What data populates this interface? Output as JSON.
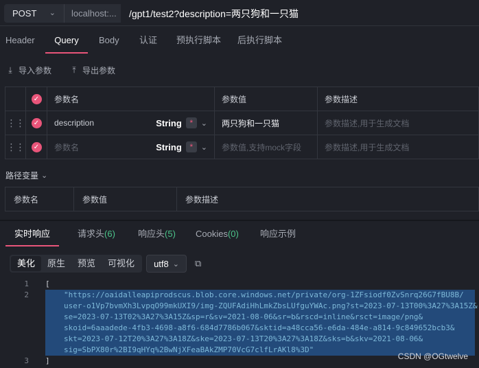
{
  "request": {
    "method": "POST",
    "host": "localhost:...",
    "path": "/gpt1/test2?description=两只狗和一只猫"
  },
  "tabs": [
    "Header",
    "Query",
    "Body",
    "认证",
    "预执行脚本",
    "后执行脚本"
  ],
  "active_tab": "Query",
  "toolbar": {
    "import_label": "导入参数",
    "export_label": "导出参数"
  },
  "params_table": {
    "headers": [
      "参数名",
      "参数值",
      "参数描述"
    ],
    "rows": [
      {
        "name": "description",
        "type": "String",
        "required_mark": "*",
        "value": "两只狗和一只猫",
        "desc_placeholder": "参数描述,用于生成文档"
      },
      {
        "name_placeholder": "参数名",
        "type": "String",
        "required_mark": "*",
        "value_placeholder": "参数值,支持mock字段",
        "desc_placeholder": "参数描述,用于生成文档"
      }
    ]
  },
  "path_vars": {
    "label": "路径变量",
    "headers": [
      "参数名",
      "参数值",
      "参数描述"
    ]
  },
  "response_tabs": {
    "realtime": "实时响应",
    "req_headers": "请求头",
    "req_headers_count": "(6)",
    "resp_headers": "响应头",
    "resp_headers_count": "(5)",
    "cookies": "Cookies",
    "cookies_count": "(0)",
    "example": "响应示例"
  },
  "format": {
    "buttons": [
      "美化",
      "原生",
      "预览",
      "可视化"
    ],
    "active": "美化",
    "encoding": "utf8"
  },
  "code": {
    "line_numbers": [
      "1",
      "2",
      "3"
    ],
    "open": "[",
    "close": "]",
    "string_lines": [
      "\"https://oaidalleapiprodscus.blob.core.windows.net/private/org-1ZFsiodf0ZvSnrq26G7fBU8B/",
      "user-o1Vp7bvmXh3LvpqO99mkUXI9/img-ZQUFAdiHhLmkZbsLUfguYWAc.png?st=2023-07-13T00%3A27%3A15Z&",
      "se=2023-07-13T02%3A27%3A15Z&sp=r&sv=2021-08-06&sr=b&rscd=inline&rsct=image/png&",
      "skoid=6aaadede-4fb3-4698-a8f6-684d7786b067&sktid=a48cca56-e6da-484e-a814-9c849652bcb3&",
      "skt=2023-07-12T20%3A27%3A18Z&ske=2023-07-13T20%3A27%3A18Z&sks=b&skv=2021-08-06&",
      "sig=SbPX80r%2BI9qHYq%2BwNjXFeaBAkZMP70VcG7clfLrAKl8%3D\""
    ]
  },
  "watermark": "CSDN @OGtwelve"
}
